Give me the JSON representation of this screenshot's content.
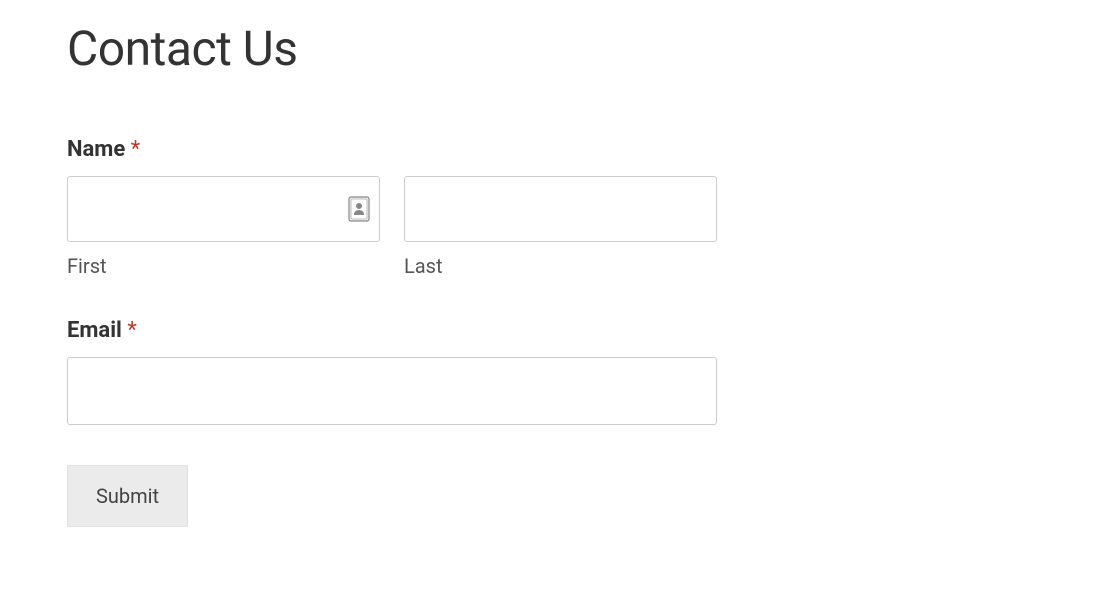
{
  "title": "Contact Us",
  "form": {
    "name": {
      "label": "Name",
      "required_marker": "*",
      "first": {
        "sublabel": "First",
        "value": ""
      },
      "last": {
        "sublabel": "Last",
        "value": ""
      }
    },
    "email": {
      "label": "Email",
      "required_marker": "*",
      "value": ""
    },
    "submit_label": "Submit"
  }
}
